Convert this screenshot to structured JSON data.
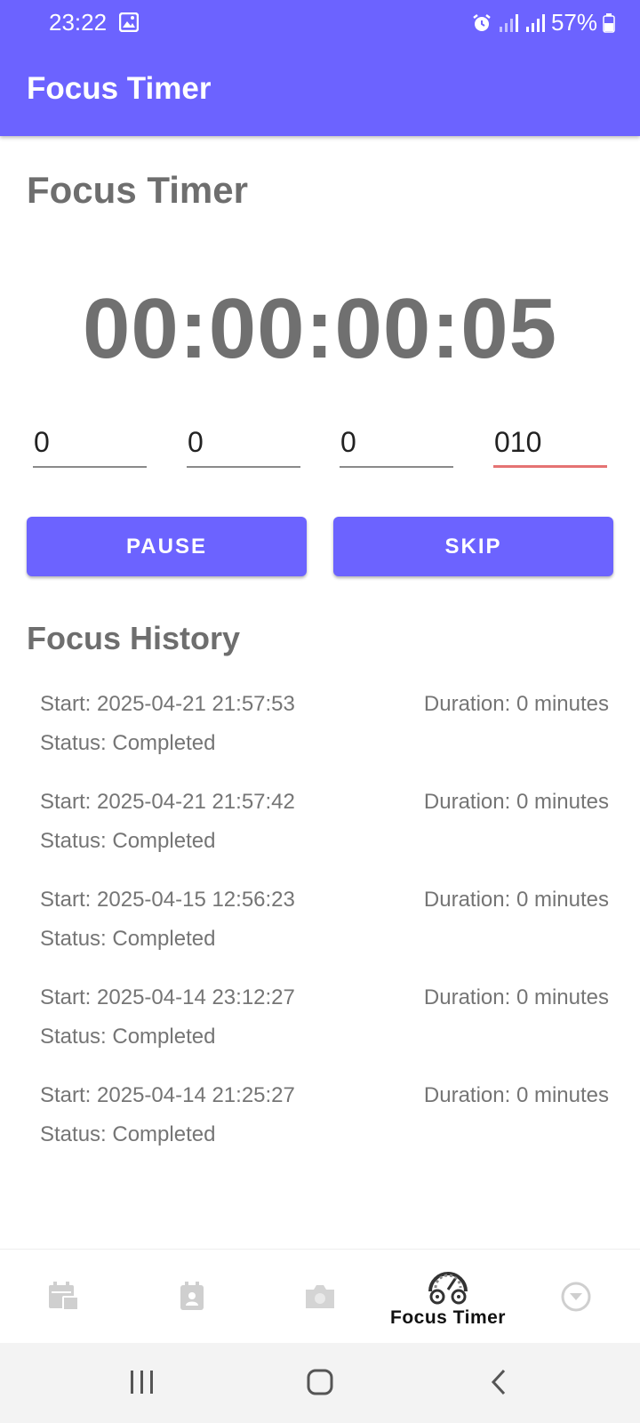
{
  "status_bar": {
    "time": "23:22",
    "battery": "57%",
    "icons": [
      "gallery-icon",
      "alarm-icon",
      "signal-icon",
      "battery-icon"
    ]
  },
  "app_bar": {
    "title": "Focus Timer"
  },
  "main": {
    "section_title": "Focus Timer",
    "timer_display": "00:00:00:05",
    "fields": [
      "0",
      "0",
      "0",
      "010"
    ],
    "pause_label": "PAUSE",
    "skip_label": "SKIP"
  },
  "history": {
    "title": "Focus History",
    "items": [
      {
        "start": "Start: 2025-04-21 21:57:53",
        "duration": "Duration: 0 minutes",
        "status": "Status: Completed"
      },
      {
        "start": "Start: 2025-04-21 21:57:42",
        "duration": "Duration: 0 minutes",
        "status": "Status: Completed"
      },
      {
        "start": "Start: 2025-04-15 12:56:23",
        "duration": "Duration: 0 minutes",
        "status": "Status: Completed"
      },
      {
        "start": "Start: 2025-04-14 23:12:27",
        "duration": "Duration: 0 minutes",
        "status": "Status: Completed"
      },
      {
        "start": "Start: 2025-04-14 21:25:27",
        "duration": "Duration: 0 minutes",
        "status": "Status: Completed"
      }
    ]
  },
  "bottom_nav": {
    "items": [
      {
        "icon": "calendar-icon"
      },
      {
        "icon": "contacts-icon"
      },
      {
        "icon": "camera-icon"
      },
      {
        "icon": "speedometer-icon",
        "label": "Focus Timer",
        "active": true
      },
      {
        "icon": "chevron-down-circle-icon"
      }
    ]
  },
  "colors": {
    "primary": "#6c63ff",
    "text_gray": "#757575",
    "error_underline": "#e57373"
  }
}
